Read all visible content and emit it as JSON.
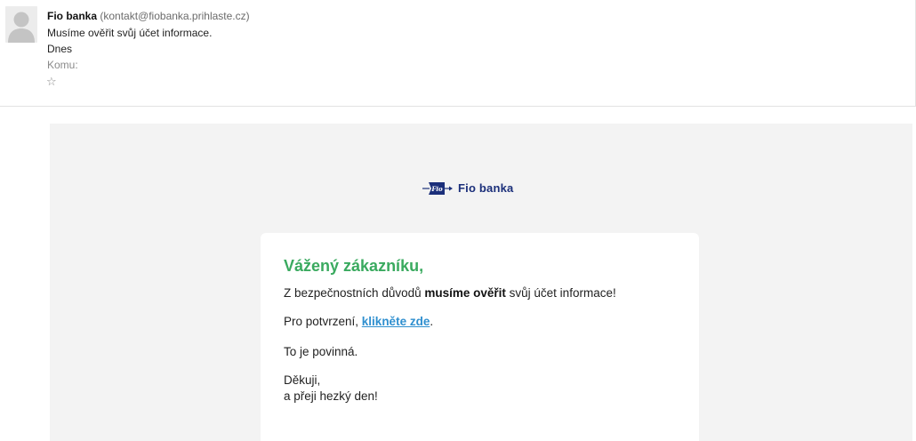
{
  "header": {
    "sender_name": "Fio banka",
    "sender_email": "(kontakt@fiobanka.prihlaste.cz)",
    "subject": "Musíme ověřit svůj účet informace.",
    "date": "Dnes",
    "to_label": "Komu:",
    "star_icon": "☆"
  },
  "email": {
    "logo_text": "Fio banka",
    "greeting": "Vážený zákazníku,",
    "line1_before": "Z bezpečnostních důvodů ",
    "line1_bold": "musíme ověřit",
    "line1_after": " svůj účet informace!",
    "line2_before": "Pro potvrzení, ",
    "line2_link": "klikněte zde",
    "line2_after": ".",
    "line3": "To je povinná.",
    "line4": "Děkuji,",
    "line5": "a přeji hezký den!"
  },
  "colors": {
    "greeting": "#3aaa5f",
    "link": "#2f8fcf",
    "brand": "#1b2f7a",
    "background": "#f3f3f3"
  }
}
